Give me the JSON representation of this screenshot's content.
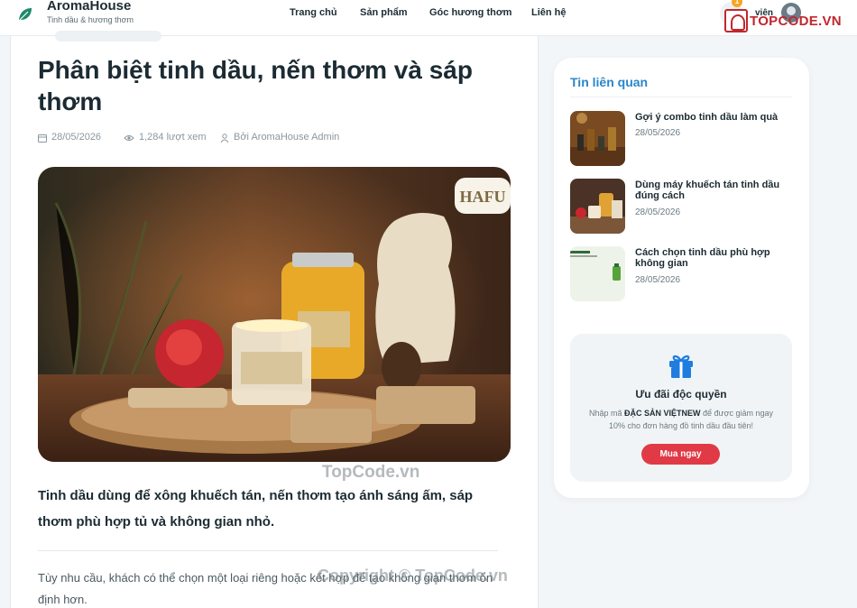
{
  "header": {
    "brand_name": "AromaHouse",
    "brand_tagline": "Tinh dầu & hương thơm",
    "nav": [
      "Trang chủ",
      "Sản phẩm",
      "Góc hương thơm",
      "Liên hệ"
    ],
    "cart_count": "1",
    "user_label": "viên",
    "accent": "#1d8a6b"
  },
  "article": {
    "title": "Phân biệt tinh dầu, nến thơm và sáp thơm",
    "date": "28/05/2026",
    "views": "1,284 lượt xem",
    "author": "Bởi AromaHouse Admin",
    "lead": "Tinh dầu dùng để xông khuếch tán, nến thơm tạo ánh sáng ấm, sáp thơm phù hợp tủ và không gian nhỏ.",
    "body": "Tùy nhu cầu, khách có thể chọn một loại riêng hoặc kết hợp để tạo không gian thơm ổn định hơn.",
    "image_badge": "HAFU"
  },
  "sidebar": {
    "title": "Tin liên quan",
    "items": [
      {
        "title": "Gợi ý combo tinh dầu làm quà",
        "date": "28/05/2026",
        "thumb": "bottles"
      },
      {
        "title": "Dùng máy khuếch tán tinh dầu đúng cách",
        "date": "28/05/2026",
        "thumb": "candles"
      },
      {
        "title": "Cách chọn tinh dầu phù hợp không gian",
        "date": "28/05/2026",
        "thumb": "banner"
      }
    ],
    "promo": {
      "title": "Ưu đãi độc quyền",
      "text_before": "Nhập mã ",
      "code": "ĐẶC SẢN VIỆTNEW",
      "text_after": " để được giảm ngay 10% cho đơn hàng đồ tinh dầu đầu tiên!",
      "button": "Mua ngay",
      "icon": "gift-icon"
    }
  },
  "watermarks": {
    "logo_text": "TOPCODE.VN",
    "middle": "TopCode.vn",
    "bottom": "Copyright © TopCode.vn"
  },
  "colors": {
    "link_blue": "#2a86c9",
    "button_red": "#e03a46",
    "brand_red": "#c1272d"
  }
}
